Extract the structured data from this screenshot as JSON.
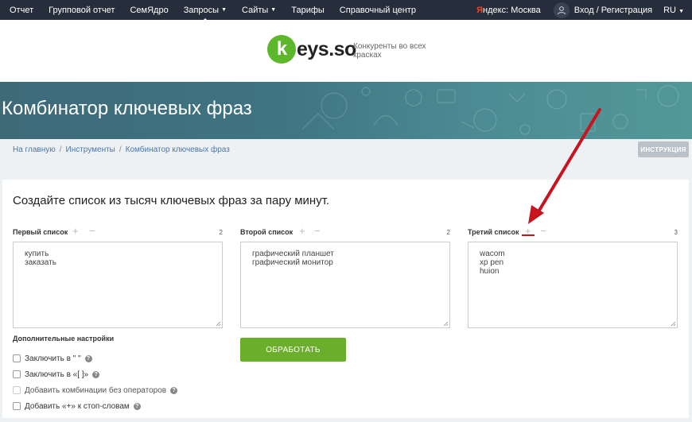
{
  "nav": {
    "items": [
      {
        "label": "Отчет",
        "caret": false
      },
      {
        "label": "Групповой отчет",
        "caret": false
      },
      {
        "label": "СемЯдро",
        "caret": false
      },
      {
        "label": "Запросы",
        "caret": true
      },
      {
        "label": "Сайты",
        "caret": true
      },
      {
        "label": "Тарифы",
        "caret": false
      },
      {
        "label": "Справочный центр",
        "caret": false
      }
    ],
    "yandex_prefix": "Я",
    "yandex_label": "ндекс: Москва",
    "login": "Вход / Регистрация",
    "lang": "RU"
  },
  "logo": {
    "mark": "k",
    "text": "eys.so",
    "tagline": "Конкуренты во всех красках"
  },
  "banner": {
    "title": "Комбинатор ключевых фраз"
  },
  "breadcrumbs": [
    "На главную",
    "Инструменты",
    "Комбинатор ключевых фраз"
  ],
  "instruction_button": "ИНСТРУКЦИЯ",
  "card": {
    "heading": "Создайте список из тысяч ключевых фраз за пару минут.",
    "lists": [
      {
        "label": "Первый список",
        "count": "2",
        "lines": [
          "купить",
          "заказать"
        ]
      },
      {
        "label": "Второй список",
        "count": "2",
        "lines": [
          "графический планшет",
          "графический монитор"
        ]
      },
      {
        "label": "Третий список",
        "count": "3",
        "lines": [
          "wacom",
          "xp pen",
          "huion"
        ]
      }
    ],
    "settings_title": "Дополнительные настройки",
    "options": [
      {
        "label": "Заключить в \" \"",
        "disabled": false
      },
      {
        "label": "Заключить в «[ ]»",
        "disabled": false
      },
      {
        "label": "Добавить комбинации без операторов",
        "disabled": true
      },
      {
        "label": "Добавить «+» к стоп-словам",
        "disabled": false
      }
    ],
    "process_button": "ОБРАБОТАТЬ"
  },
  "colors": {
    "nav_bg": "#262e3b",
    "accent_green": "#6bae2b",
    "logo_green": "#5cb82a",
    "annotation_red": "#c8141e"
  },
  "icons": {
    "avatar": "user-icon",
    "help": "question-icon",
    "add": "plus-icon",
    "remove": "minus-icon"
  }
}
